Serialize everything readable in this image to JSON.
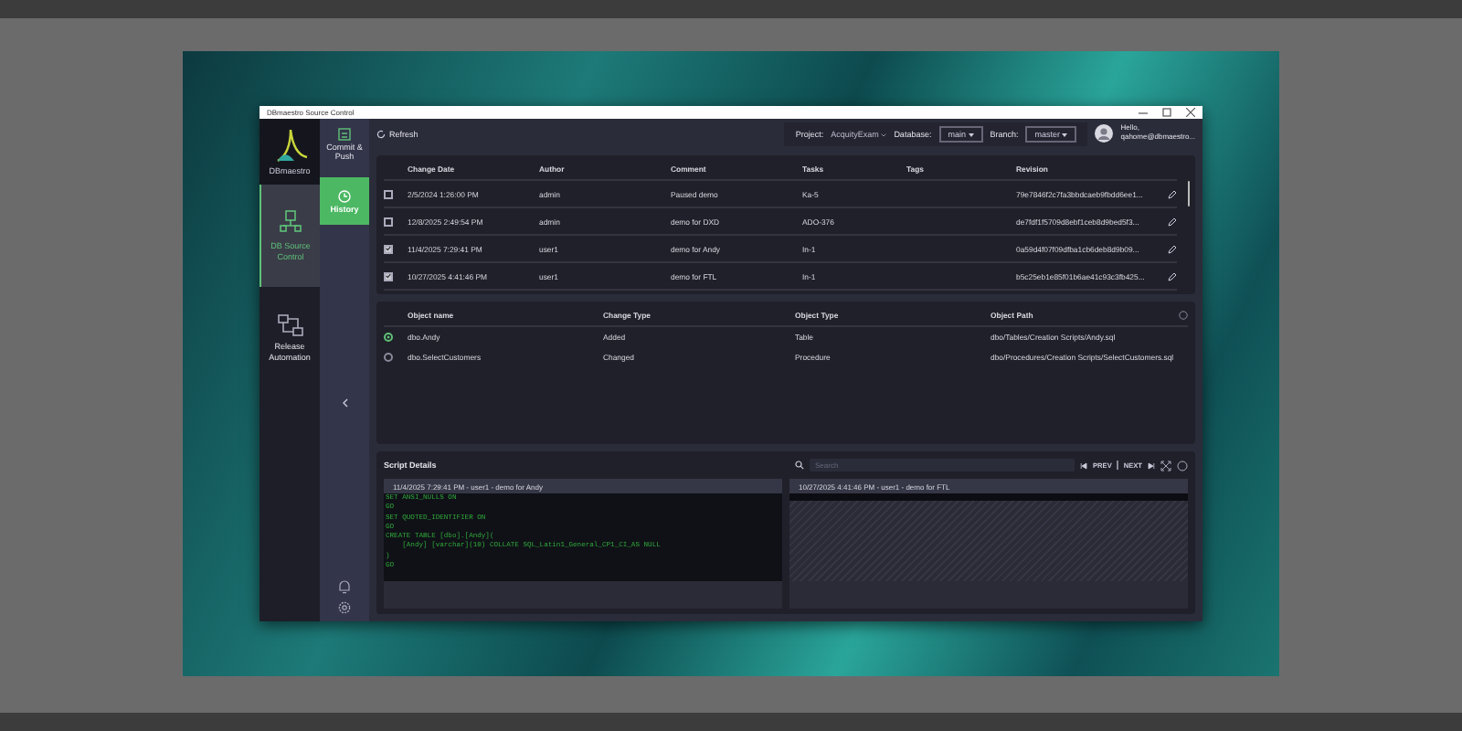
{
  "window": {
    "title": "DBmaestro Source Control"
  },
  "logo": {
    "text": "DBmaestro"
  },
  "nav": [
    {
      "label": "DB Source Control",
      "selected": true,
      "kind": "db"
    },
    {
      "label": "Release Automation",
      "selected": false,
      "kind": "release"
    }
  ],
  "subnav": [
    {
      "label": "Commit & Push",
      "selected": false,
      "kind": "commit"
    },
    {
      "label": "History",
      "selected": true,
      "kind": "history"
    }
  ],
  "toolbar": {
    "refresh": "Refresh",
    "project_label": "Project:",
    "project": "AcquityExam",
    "database_label": "Database:",
    "database": "main",
    "branch_label": "Branch:",
    "branch": "master",
    "greeting": "Hello,",
    "user": "qahome@dbmaestro..."
  },
  "history": {
    "columns": [
      "Change Date",
      "Author",
      "Comment",
      "Tasks",
      "Tags",
      "Revision"
    ],
    "rows": [
      {
        "checked": false,
        "cells": [
          "2/5/2024 1:26:00 PM",
          "admin",
          "Paused demo",
          "Ka-5",
          "",
          "79e7846f2c7fa3bbdcaeb9fbdd6ee1..."
        ]
      },
      {
        "checked": false,
        "cells": [
          "12/8/2025 2:49:54 PM",
          "admin",
          "demo for DXD",
          "ADO-376",
          "",
          "de7fdf1f5709d8ebf1ceb8d9bed5f3..."
        ]
      },
      {
        "checked": true,
        "cells": [
          "11/4/2025 7:29:41 PM",
          "user1",
          "demo for Andy",
          "In-1",
          "",
          "0a59d4f07f09dfba1cb6deb8d9b09..."
        ]
      },
      {
        "checked": true,
        "cells": [
          "10/27/2025 4:41:46 PM",
          "user1",
          "demo for FTL",
          "In-1",
          "",
          "b5c25eb1e85f01b6ae41c93c3fb425..."
        ]
      }
    ]
  },
  "objects": {
    "columns": [
      "Object name",
      "Change Type",
      "Object Type",
      "Object Path"
    ],
    "rows": [
      {
        "selected": true,
        "cells": [
          "dbo.Andy",
          "Added",
          "Table",
          "dbo/Tables/Creation Scripts/Andy.sql"
        ]
      },
      {
        "selected": false,
        "cells": [
          "dbo.SelectCustomers",
          "Changed",
          "Procedure",
          "dbo/Procedures/Creation Scripts/SelectCustomers.sql"
        ]
      }
    ]
  },
  "script": {
    "title": "Script Details",
    "search_placeholder": "Search",
    "prev": "PREV",
    "next": "NEXT",
    "left": {
      "header": "11/4/2025 7:29:41 PM - user1 - demo for Andy",
      "lines": [
        "SET ANSI_NULLS ON",
        "GO",
        "SET QUOTED_IDENTIFIER ON",
        "GO",
        "CREATE TABLE [dbo].[Andy](",
        "    [Andy] [varchar](10) COLLATE SQL_Latin1_General_CP1_CI_AS NULL",
        ")",
        "GO"
      ]
    },
    "right": {
      "header": "10/27/2025 4:41:46 PM - user1 - demo for FTL"
    }
  }
}
